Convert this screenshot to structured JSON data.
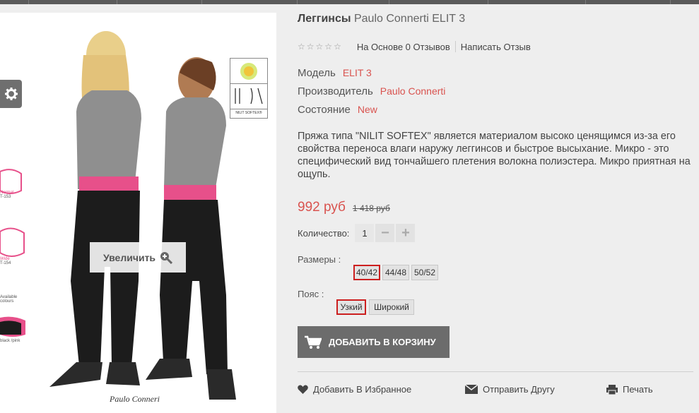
{
  "product": {
    "title_main": "Леггинсы",
    "title_rest": "Paulo Connerti ELIT 3"
  },
  "reviews": {
    "based_on": "На Основе 0 Отзывов",
    "write": "Написать Отзыв"
  },
  "specs": {
    "model_label": "Модель",
    "model_value": "ELIT 3",
    "maker_label": "Производитель",
    "maker_value": "Paulo Connerti",
    "condition_label": "Состояние",
    "condition_value": "New"
  },
  "description": "Пряжа типа \"NILIT SOFTEX\" является материалом высоко ценящимся из-за его свойства переноса влаги наружу леггинсов и быстрое высыхание. Микро - это специфический вид тончайшего плетения волокна полиэстера. Микро приятная на ощупь.",
  "price": {
    "new": "992 руб",
    "old": "1 418 руб"
  },
  "quantity": {
    "label": "Количество:",
    "value": "1"
  },
  "sizes": {
    "label": "Размеры :",
    "options": [
      "40/42",
      "44/48",
      "50/52"
    ],
    "selected": "40/42"
  },
  "belt": {
    "label": "Пояс :",
    "options": [
      "Узкий",
      "Широкий"
    ],
    "selected": "Узкий"
  },
  "cart": {
    "label": "ДОБАВИТЬ В КОРЗИНУ"
  },
  "actions": {
    "wishlist": "Добавить В Избранное",
    "send": "Отправить Другу",
    "print": "Печать"
  },
  "image": {
    "zoom": "Увеличить",
    "brand": "Paulo Conneri",
    "cert": "NILIT SOFTEX®",
    "size_normal": "Normal",
    "size_normal_code": "T-153",
    "size_wide": "Wide",
    "size_wide_code": "T-154",
    "avail": "Available colours",
    "black_pink": "black /pink"
  },
  "colors": {
    "accent": "#d9534f",
    "selected_border": "#cc1f1f",
    "button_bg": "#6c6c6c"
  }
}
